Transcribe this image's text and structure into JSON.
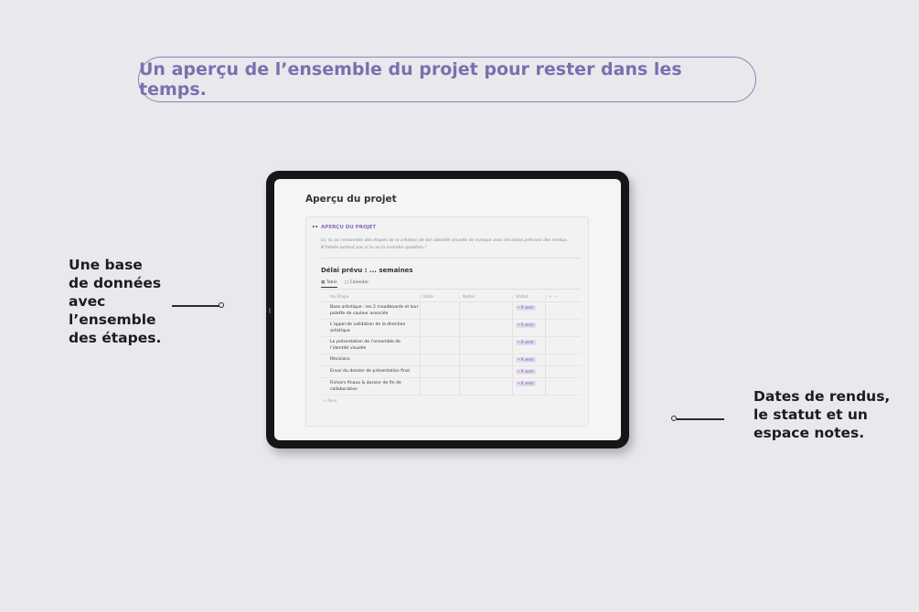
{
  "headline": "Un aperçu de l’ensemble du projet pour rester dans les temps.",
  "callout_left": [
    "Une base",
    "de données",
    "avec",
    "l’ensemble",
    "des étapes."
  ],
  "callout_right": [
    "Dates de rendus,",
    "le statut et un",
    "espace notes."
  ],
  "screen": {
    "page_title": "Aperçu du projet",
    "card_header_icon": "••",
    "card_header": "APERÇU DU PROJET",
    "intro": "Ici, tu as l’ensemble des étapes de la création de ton identité visuelle de marque avec les dates précises des rendus. N’hésite surtout pas si tu as la moindre question !",
    "delay_title": "Délai prévu : ... semaines",
    "views": {
      "table": "Table",
      "calendar": "Calendar"
    },
    "columns": {
      "step": "Aa Étape",
      "date": "Date",
      "notes": "Notes",
      "status": "Statut",
      "extra": "+ ···"
    },
    "rows": [
      {
        "step": "Base artistique : les 2 moodboards et leur palette de couleur associée",
        "status": "• À venir"
      },
      {
        "step": "L’appel de validation de la direction artistique",
        "status": "• À venir"
      },
      {
        "step": "La présentation de l’ensemble de l’identité visuelle",
        "status": "• À venir"
      },
      {
        "step": "Révisions",
        "status": "• À venir"
      },
      {
        "step": "Envoi du dossier de présentation final",
        "status": "• À venir"
      },
      {
        "step": "Fichiers finaux & dossier de fin de collaboration",
        "status": "• À venir"
      }
    ],
    "new_label": "+ New"
  },
  "colors": {
    "accent": "#7a70b0",
    "background": "#e9e8ec",
    "badge": "#e3d9ef"
  }
}
